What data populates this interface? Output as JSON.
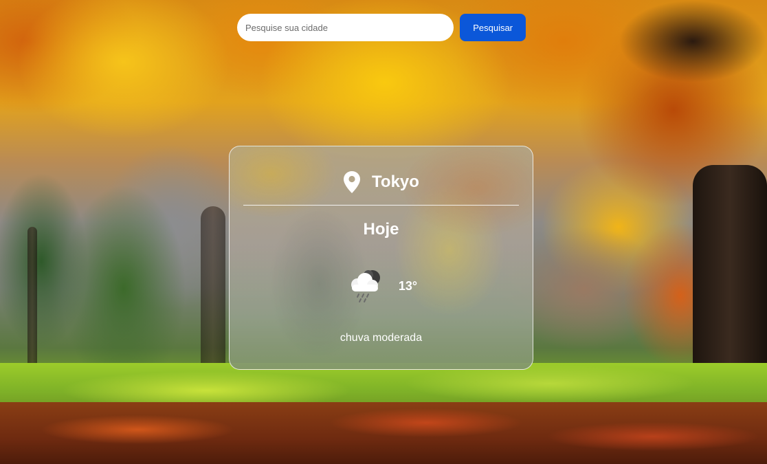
{
  "search": {
    "placeholder": "Pesquise sua cidade",
    "value": "",
    "button_label": "Pesquisar"
  },
  "weather": {
    "city": "Tokyo",
    "day": "Hoje",
    "temperature": "13°",
    "description": "chuva moderada",
    "icon": "rain-cloud-night-icon",
    "location_icon": "location-pin-icon"
  },
  "colors": {
    "button_bg": "#0b57d9",
    "button_text": "#ffffff",
    "card_text": "#ffffff"
  }
}
